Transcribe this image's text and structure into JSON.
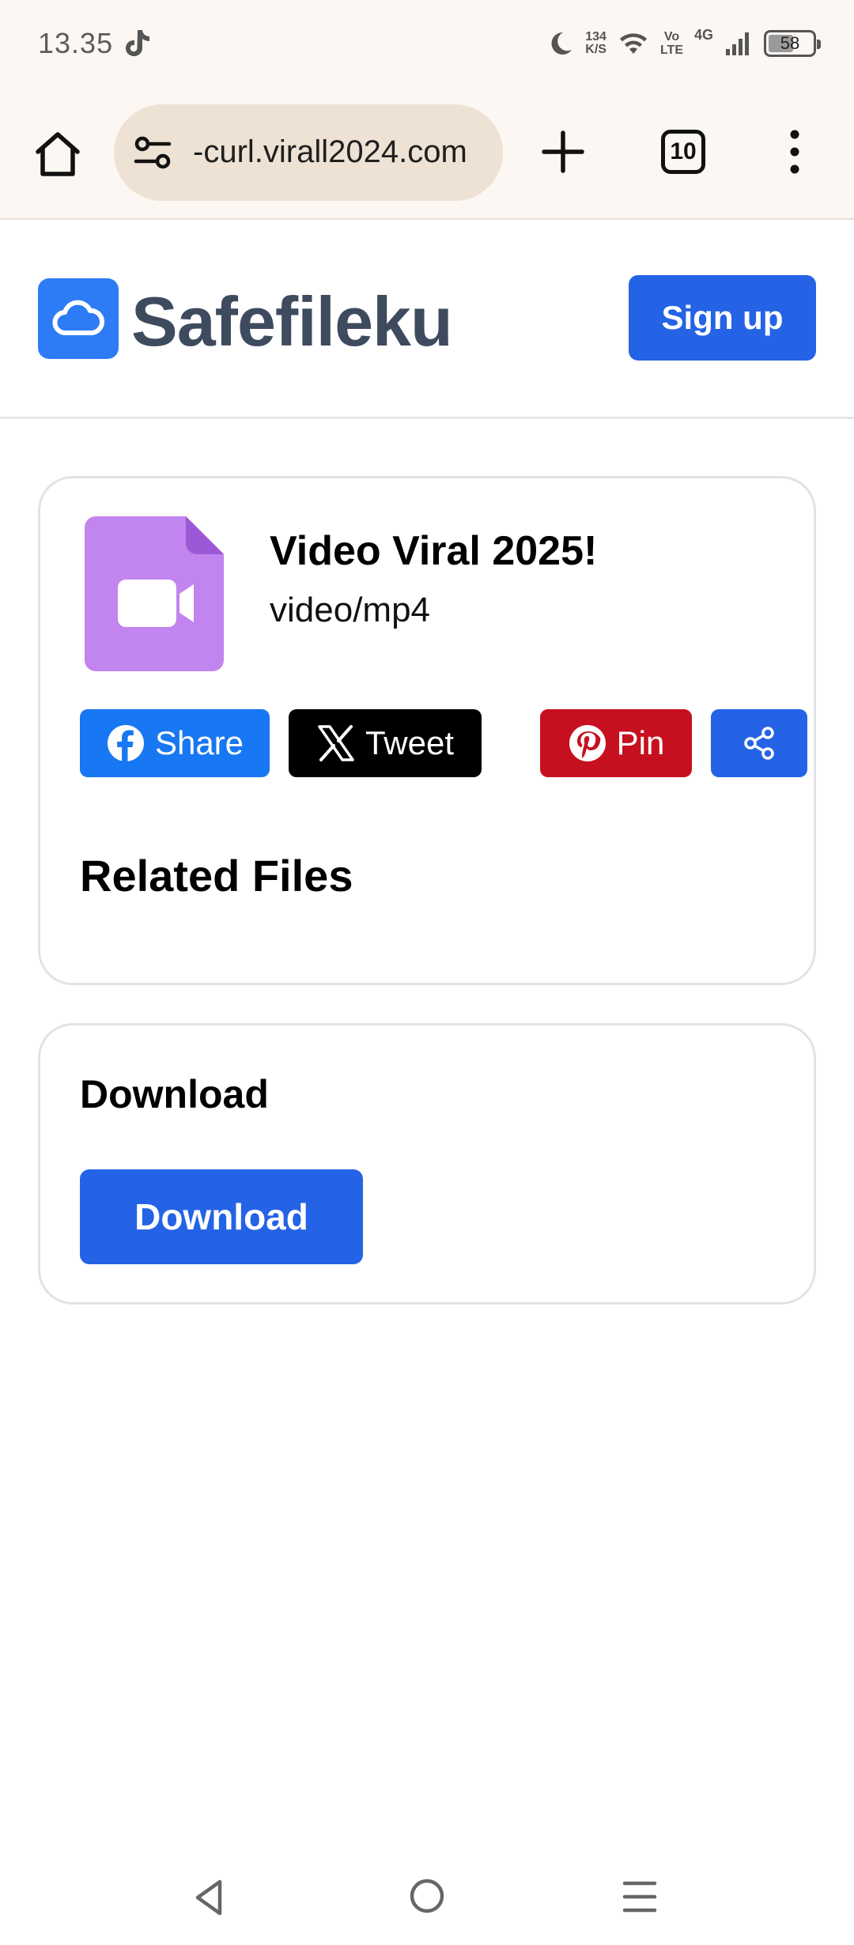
{
  "status_bar": {
    "time": "13.35",
    "net_speed_value": "134",
    "net_speed_unit": "K/S",
    "volte_top": "Vo",
    "volte_bottom": "LTE",
    "network": "4G",
    "battery": "58",
    "battery_level": 0.58
  },
  "browser": {
    "url": "-curl.virall2024.com",
    "tab_count": "10"
  },
  "site": {
    "logo_text": "Safefileku",
    "signup_label": "Sign up",
    "brand_color": "#2563e6"
  },
  "file": {
    "title": "Video Viral 2025!",
    "mime_type": "video/mp4",
    "icon": "video-file-icon",
    "icon_color": "#c284ee"
  },
  "share": {
    "facebook_label": "Share",
    "x_label": "Tweet",
    "pinterest_label": "Pin",
    "facebook_color": "#1877f2",
    "x_color": "#000000",
    "pinterest_color": "#c7101f"
  },
  "related": {
    "title": "Related Files"
  },
  "download": {
    "title": "Download",
    "button_label": "Download"
  }
}
